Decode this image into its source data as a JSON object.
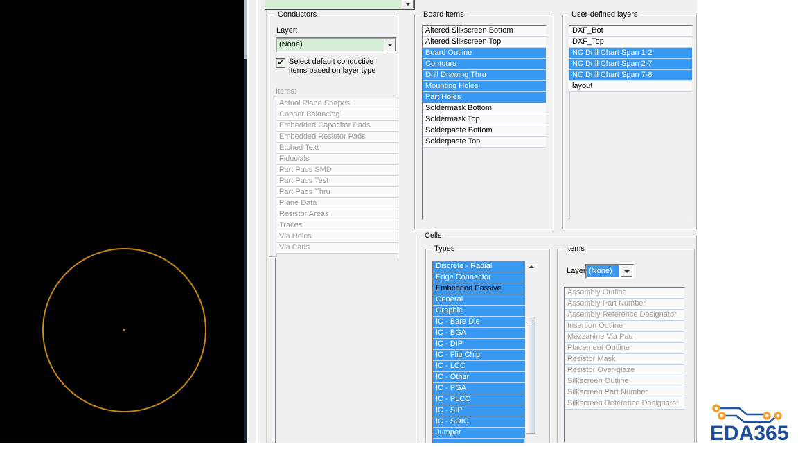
{
  "colors": {
    "sel": "#3898f2",
    "red": "#d40000",
    "green": "#d5eed5",
    "circle": "#c8890e",
    "logo-blue": "#1d4f9e",
    "logo-orange": "#f0a030"
  },
  "panel": {
    "top_combo": {
      "value": ""
    },
    "conductors": {
      "title": "Conductors",
      "layer_label": "Layer:",
      "layer_value": "(None)",
      "checkbox": {
        "checked": true,
        "label_line1": "Select default conductive",
        "label_line2": "items based on layer type"
      },
      "items_label": "Items:",
      "items": [
        "Actual Plane Shapes",
        "Copper Balancing",
        "Embedded Capacitor Pads",
        "Embedded Resistor Pads",
        "Etched Text",
        "Fiducials",
        "Part Pads SMD",
        "Part Pads Test",
        "Part Pads Thru",
        "Plane Data",
        "Resistor Areas",
        "Traces",
        "Via Holes",
        "Via Pads"
      ]
    },
    "board_items": {
      "title": "Board items",
      "items": [
        {
          "label": "Altered Silkscreen Bottom",
          "selected": false
        },
        {
          "label": "Altered Silkscreen Top",
          "selected": false
        },
        {
          "label": "Board Outline",
          "selected": true
        },
        {
          "label": "Contours",
          "selected": true,
          "highlighted": true
        },
        {
          "label": "Drill Drawing Thru",
          "selected": true
        },
        {
          "label": "Mounting Holes",
          "selected": true
        },
        {
          "label": "Part Holes",
          "selected": true
        },
        {
          "label": "Soldermask Bottom",
          "selected": false
        },
        {
          "label": "Soldermask Top",
          "selected": false
        },
        {
          "label": "Solderpaste Bottom",
          "selected": false
        },
        {
          "label": "Solderpaste Top",
          "selected": false
        }
      ]
    },
    "user_layers": {
      "title": "User-defined layers",
      "items": [
        {
          "label": "DXF_Bot",
          "selected": false
        },
        {
          "label": "DXF_Top",
          "selected": false
        },
        {
          "label": "NC Drill Chart Span 1-2",
          "selected": true
        },
        {
          "label": "NC Drill Chart Span 2-7",
          "selected": true
        },
        {
          "label": "NC Drill Chart Span 7-8",
          "selected": true
        },
        {
          "label": "layout",
          "selected": false
        }
      ]
    },
    "cells": {
      "title": "Cells",
      "types": {
        "title": "Types",
        "items": [
          {
            "label": "Discrete - Radial",
            "selected": true
          },
          {
            "label": "Edge Connector",
            "selected": true
          },
          {
            "label": "Embedded Passive",
            "selected": true,
            "focus": true
          },
          {
            "label": "General",
            "selected": true
          },
          {
            "label": "Graphic",
            "selected": true
          },
          {
            "label": "IC - Bare Die",
            "selected": true
          },
          {
            "label": "IC - BGA",
            "selected": true
          },
          {
            "label": "IC - DIP",
            "selected": true
          },
          {
            "label": "IC - Flip Chip",
            "selected": true
          },
          {
            "label": "IC - LCC",
            "selected": true
          },
          {
            "label": "IC - Other",
            "selected": true
          },
          {
            "label": "IC - PGA",
            "selected": true
          },
          {
            "label": "IC - PLCC",
            "selected": true
          },
          {
            "label": "IC - SIP",
            "selected": true
          },
          {
            "label": "IC - SOIC",
            "selected": true
          },
          {
            "label": "Jumper",
            "selected": true
          }
        ]
      },
      "items_group": {
        "title": "Items",
        "layer_label": "Layer:",
        "layer_value": "(None)",
        "items": [
          "Assembly Outline",
          "Assembly Part Number",
          "Assembly Reference Designator",
          "Insertion Outline",
          "Mezzanine Via Pad",
          "Placement Outline",
          "Resistor Mask",
          "Resistor Over-glaze",
          "Silkscreen Outline",
          "Silkscreen Part Number",
          "Silkscreen Reference Designator"
        ]
      }
    }
  },
  "logo": {
    "text": "EDA365"
  }
}
